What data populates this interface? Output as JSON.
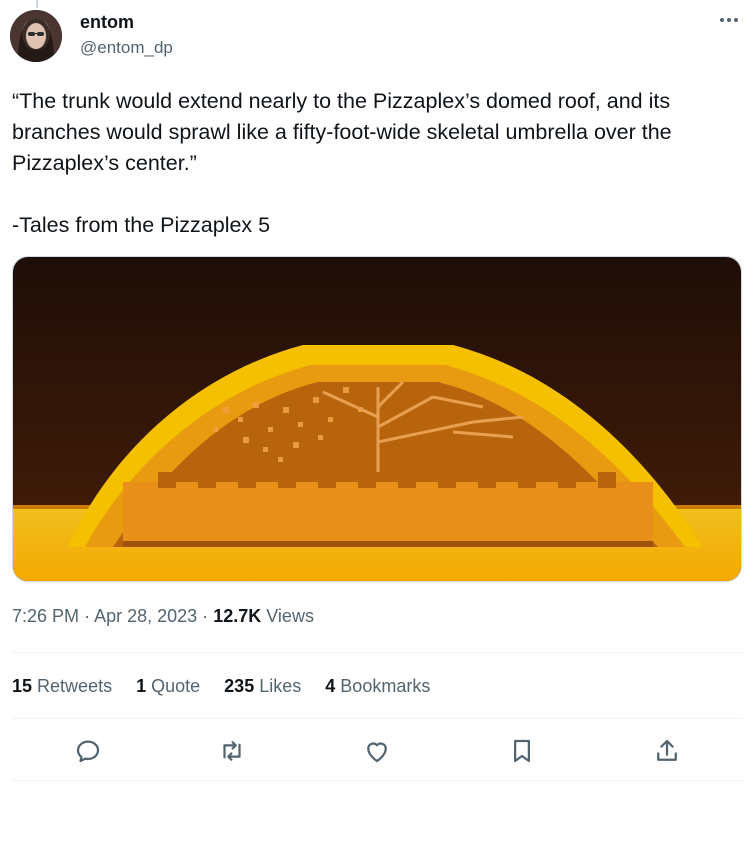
{
  "author": {
    "display_name": "entom",
    "handle": "@entom_dp",
    "avatar_icon": "avatar-photo"
  },
  "tweet": {
    "text": "“The trunk would extend nearly to the Pizzaplex’s domed roof, and its branches would sprawl like a fifty-foot-wide skeletal umbrella over the Pizzaplex’s center.”\n\n-Tales from the Pizzaplex 5",
    "media_icon": "pixel-art-dome-with-tree-image"
  },
  "meta": {
    "time": "7:26 PM",
    "separator": "·",
    "date": "Apr 28, 2023",
    "views_count": "12.7K",
    "views_label": "Views"
  },
  "stats": {
    "retweets_count": "15",
    "retweets_label": "Retweets",
    "quotes_count": "1",
    "quotes_label": "Quote",
    "likes_count": "235",
    "likes_label": "Likes",
    "bookmarks_count": "4",
    "bookmarks_label": "Bookmarks"
  },
  "actions": {
    "reply_icon": "reply-icon",
    "retweet_icon": "retweet-icon",
    "like_icon": "heart-icon",
    "bookmark_icon": "bookmark-icon",
    "share_icon": "share-icon"
  },
  "colors": {
    "text_primary": "#0f1419",
    "text_secondary": "#536471",
    "divider": "#eff3f4",
    "icon": "#536471",
    "dome_gold": "#f5b800",
    "dome_orange": "#e08a10",
    "background_dark": "#2a1208"
  }
}
